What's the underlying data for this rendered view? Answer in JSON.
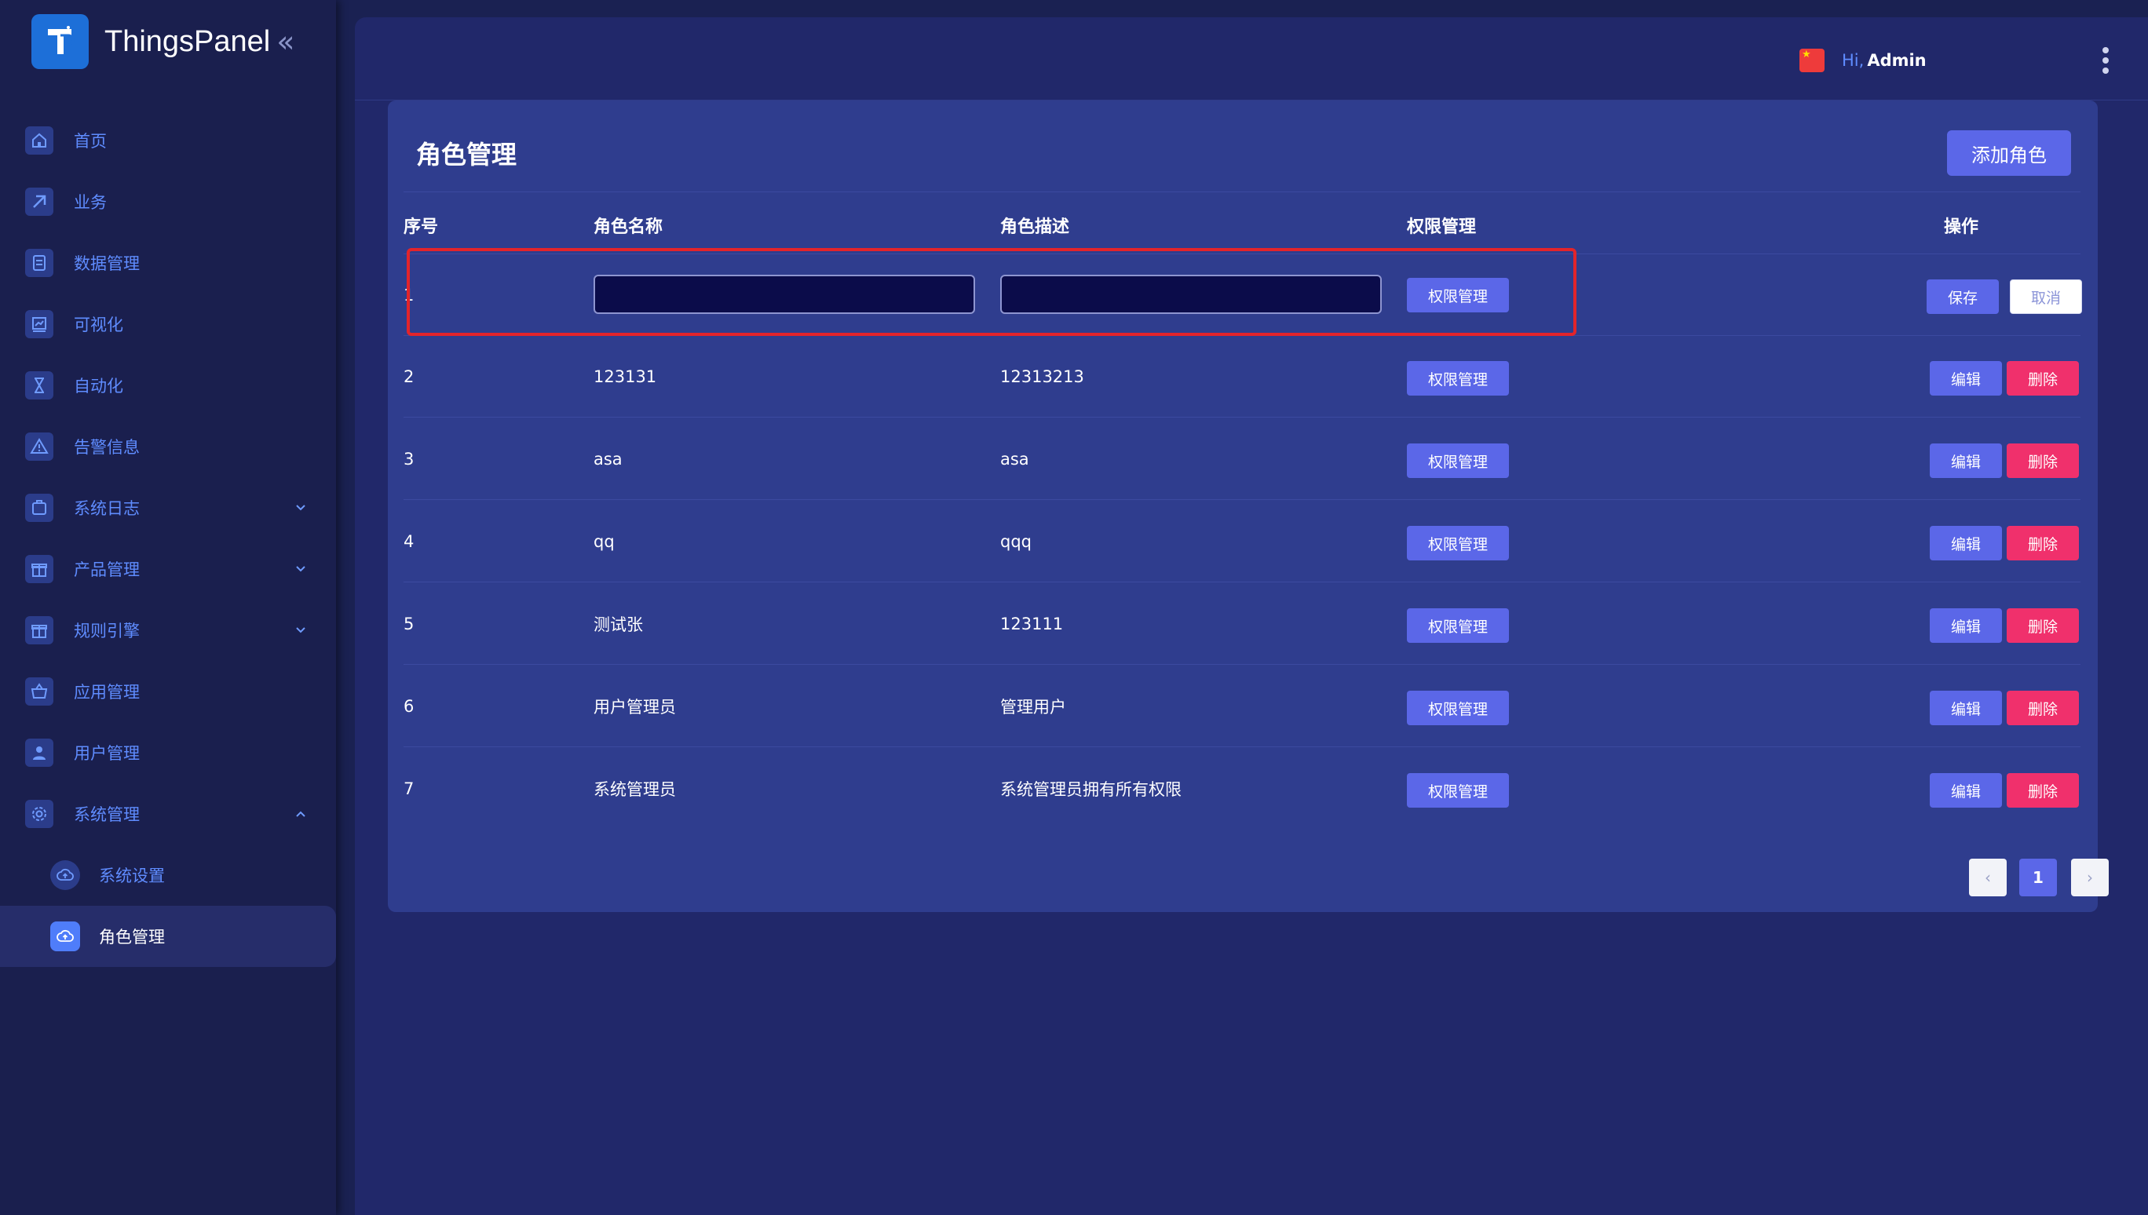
{
  "app": {
    "name": "ThingsPanel"
  },
  "sidebar": {
    "items": [
      {
        "label": "首页",
        "icon": "home-icon"
      },
      {
        "label": "业务",
        "icon": "business-icon"
      },
      {
        "label": "数据管理",
        "icon": "data-icon"
      },
      {
        "label": "可视化",
        "icon": "chart-icon"
      },
      {
        "label": "自动化",
        "icon": "hourglass-icon"
      },
      {
        "label": "告警信息",
        "icon": "warning-icon"
      },
      {
        "label": "系统日志",
        "icon": "log-icon",
        "expandable": true,
        "expanded": false
      },
      {
        "label": "产品管理",
        "icon": "gift-icon",
        "expandable": true,
        "expanded": false
      },
      {
        "label": "规则引擎",
        "icon": "gift-icon",
        "expandable": true,
        "expanded": false
      },
      {
        "label": "应用管理",
        "icon": "basket-icon"
      },
      {
        "label": "用户管理",
        "icon": "user-icon"
      },
      {
        "label": "系统管理",
        "icon": "gear-icon",
        "expandable": true,
        "expanded": true
      }
    ],
    "subitems": [
      {
        "label": "系统设置",
        "icon": "cloud-upload-icon",
        "active": false
      },
      {
        "label": "角色管理",
        "icon": "cloud-upload-icon",
        "active": true
      }
    ]
  },
  "header": {
    "hi": "Hi,",
    "user": "Admin",
    "language_flag": "china-flag-icon"
  },
  "page": {
    "title": "角色管理",
    "add_button": "添加角色",
    "columns": [
      "序号",
      "角色名称",
      "角色描述",
      "权限管理",
      "操作"
    ],
    "editing_row": {
      "index": "1",
      "name_value": "",
      "desc_value": "",
      "perm_label": "权限管理",
      "save_label": "保存",
      "cancel_label": "取消"
    },
    "rows": [
      {
        "index": "2",
        "name": "123131",
        "desc": "12313213",
        "perm_label": "权限管理",
        "edit_label": "编辑",
        "delete_label": "删除"
      },
      {
        "index": "3",
        "name": "asa",
        "desc": "asa",
        "perm_label": "权限管理",
        "edit_label": "编辑",
        "delete_label": "删除"
      },
      {
        "index": "4",
        "name": "qq",
        "desc": "qqq",
        "perm_label": "权限管理",
        "edit_label": "编辑",
        "delete_label": "删除"
      },
      {
        "index": "5",
        "name": "测试张",
        "desc": "123111",
        "perm_label": "权限管理",
        "edit_label": "编辑",
        "delete_label": "删除"
      },
      {
        "index": "6",
        "name": "用户管理员",
        "desc": "管理用户",
        "perm_label": "权限管理",
        "edit_label": "编辑",
        "delete_label": "删除"
      },
      {
        "index": "7",
        "name": "系统管理员",
        "desc": "系统管理员拥有所有权限",
        "perm_label": "权限管理",
        "edit_label": "编辑",
        "delete_label": "删除"
      }
    ],
    "pagination": {
      "prev": "‹",
      "current": "1",
      "next": "›"
    }
  },
  "colors": {
    "accent": "#5b67e8",
    "danger": "#f0306c",
    "highlight": "#e3242b",
    "sidebar_text": "#5f8cff"
  }
}
